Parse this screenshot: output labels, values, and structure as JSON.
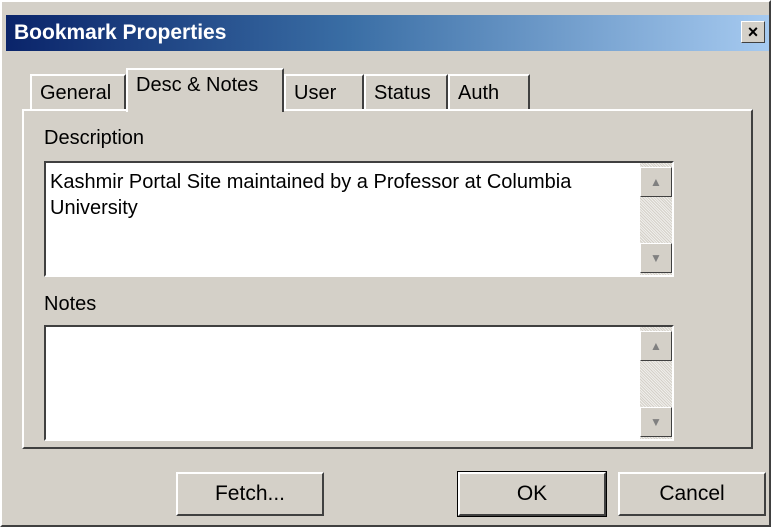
{
  "window": {
    "title": "Bookmark Properties",
    "close_label": "×"
  },
  "tabs": [
    {
      "label": "General"
    },
    {
      "label": "Desc & Notes",
      "active": true
    },
    {
      "label": "User"
    },
    {
      "label": "Status"
    },
    {
      "label": "Auth"
    }
  ],
  "description": {
    "label": "Description",
    "value": "Kashmir Portal Site maintained by a Professor at Columbia University"
  },
  "notes": {
    "label": "Notes",
    "value": ""
  },
  "scrollbar": {
    "up_glyph": "▲",
    "down_glyph": "▼"
  },
  "buttons": {
    "fetch": "Fetch...",
    "ok": "OK",
    "cancel": "Cancel"
  },
  "colors": {
    "title_gradient_start": "#0a246a",
    "title_gradient_end": "#a6caf0",
    "face": "#d4d0c8"
  }
}
